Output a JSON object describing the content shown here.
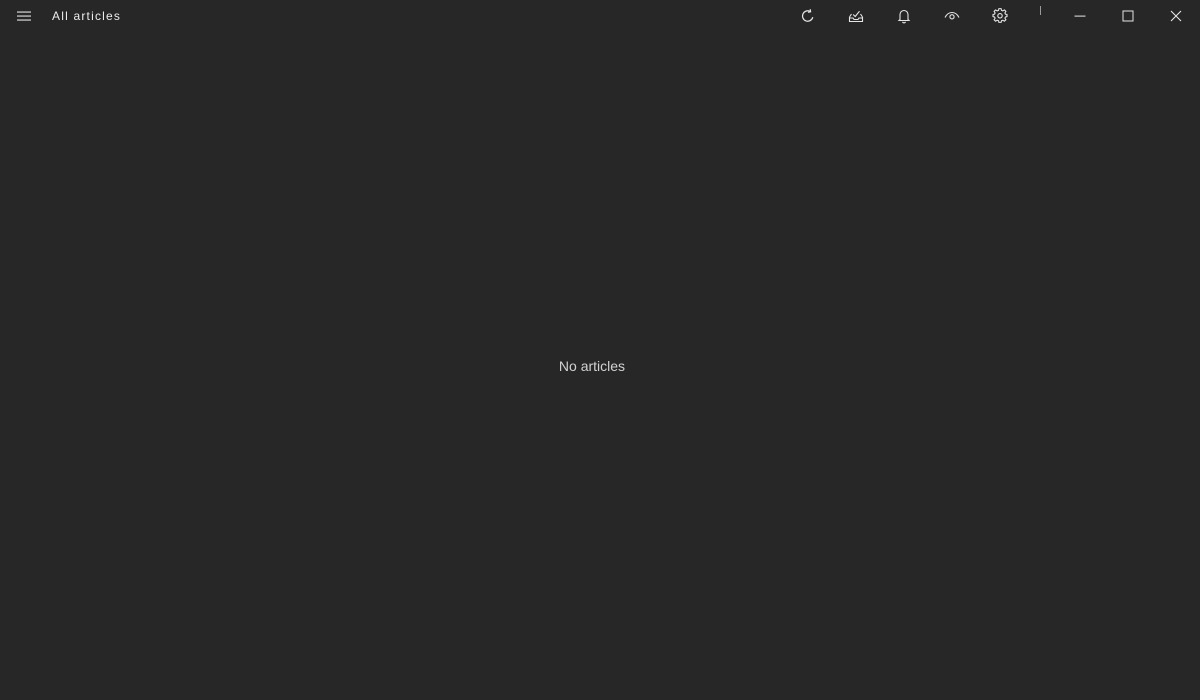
{
  "titlebar": {
    "title": "All articles",
    "menu_icon": "hamburger-menu-icon",
    "toolbar": [
      {
        "name": "refresh",
        "icon": "refresh-icon"
      },
      {
        "name": "mark-all-read",
        "icon": "mark-read-tray-icon"
      },
      {
        "name": "notifications",
        "icon": "bell-icon"
      },
      {
        "name": "view-filter",
        "icon": "eye-icon"
      },
      {
        "name": "settings",
        "icon": "gear-icon"
      }
    ],
    "window_controls": [
      {
        "name": "minimize",
        "icon": "minimize-icon"
      },
      {
        "name": "maximize",
        "icon": "maximize-icon"
      },
      {
        "name": "close",
        "icon": "close-icon"
      }
    ]
  },
  "main": {
    "empty_message": "No articles"
  },
  "colors": {
    "background": "#272727",
    "icon": "#e6e6e6",
    "text": "#ececec",
    "muted_text": "#d2d2d2"
  }
}
